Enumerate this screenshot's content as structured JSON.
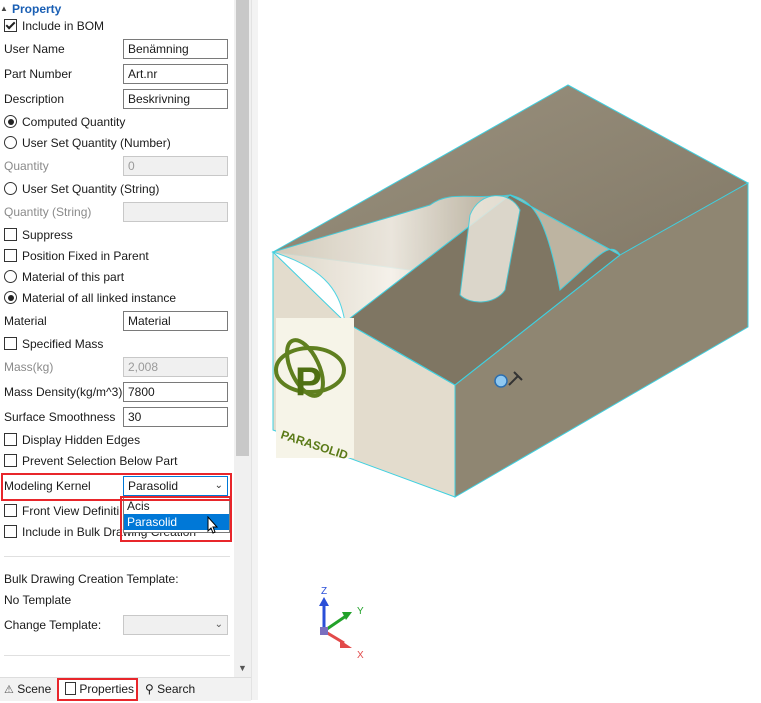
{
  "panel": {
    "header": "Property",
    "include_bom": "Include in BOM",
    "user_name_label": "User Name",
    "user_name_value": "Benämning",
    "part_number_label": "Part Number",
    "part_number_value": "Art.nr",
    "description_label": "Description",
    "description_value": "Beskrivning",
    "computed_quantity": "Computed Quantity",
    "user_set_quantity_number": "User Set Quantity (Number)",
    "quantity_label": "Quantity",
    "quantity_value": "0",
    "user_set_quantity_string": "User Set Quantity (String)",
    "quantity_string_label": "Quantity (String)",
    "suppress": "Suppress",
    "position_fixed": "Position Fixed in Parent",
    "material_this_part": "Material of this part",
    "material_linked": "Material of all linked instance",
    "material_label": "Material",
    "material_value": "Material",
    "specified_mass": "Specified Mass",
    "mass_label": "Mass(kg)",
    "mass_value": "2,008",
    "mass_density_label": "Mass Density(kg/m^3)",
    "mass_density_value": "7800",
    "surface_smoothness_label": "Surface Smoothness",
    "surface_smoothness_value": "30",
    "display_hidden_edges": "Display Hidden Edges",
    "prevent_selection": "Prevent Selection Below Part",
    "modeling_kernel_label": "Modeling Kernel",
    "modeling_kernel_value": "Parasolid",
    "front_view": "Front View Definiti",
    "include_bulk": "Include in Bulk Drawing Creation",
    "dropdown_options": [
      "Acis",
      "Parasolid"
    ],
    "bulk_template_label": "Bulk Drawing Creation Template:",
    "bulk_template_value": "No Template",
    "change_template_label": "Change Template:"
  },
  "tabs": {
    "scene": "Scene",
    "properties": "Properties",
    "search": "Search"
  },
  "viewport": {
    "logo_text": "PARASOLID",
    "axis_z": "Z",
    "axis_y": "Y",
    "axis_x": "X"
  },
  "colors": {
    "accent": "#1a5fb4",
    "highlight": "#e8262b",
    "edge": "#3fd0e0",
    "selection": "#0078d7"
  }
}
